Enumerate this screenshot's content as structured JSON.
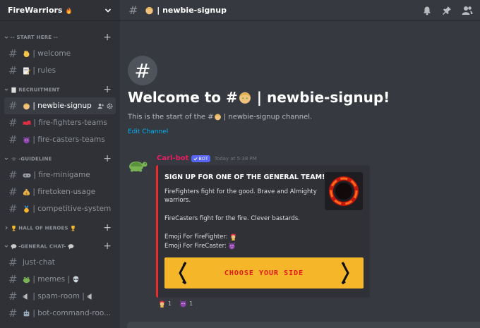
{
  "server": {
    "name": "FireWarriors"
  },
  "categories": [
    {
      "label": "-- START HERE --",
      "channels": [
        {
          "label": "| welcome"
        },
        {
          "label": "| rules"
        }
      ]
    },
    {
      "label": "RECRUITMENT",
      "channels": [
        {
          "label": "| newbie-signup"
        },
        {
          "label": "| fire-fighters-teams"
        },
        {
          "label": "| fire-casters-teams"
        }
      ]
    },
    {
      "label": "-GUIDELINE",
      "channels": [
        {
          "label": "| fire-minigame"
        },
        {
          "label": "| firetoken-usage"
        },
        {
          "label": "| competitive-system"
        }
      ]
    },
    {
      "label": "HALL OF HEROES",
      "channels": []
    },
    {
      "label": "-GENERAL CHAT-",
      "channels": [
        {
          "label": "just-chat"
        },
        {
          "label": "| memes |"
        },
        {
          "label": "| spam-room |"
        },
        {
          "label": "| bot-command-roo..."
        }
      ]
    }
  ],
  "topbar": {
    "title": "| newbie-signup"
  },
  "welcome": {
    "title_prefix": "Welcome to #",
    "title_suffix": " | newbie-signup!",
    "sub_prefix": "This is the start of the #",
    "sub_suffix": " | newbie-signup channel.",
    "edit_channel": "Edit Channel"
  },
  "message": {
    "author": "Carl-bot",
    "badge": "BOT",
    "timestamp": "Today at 5:38 PM",
    "embed": {
      "title": "SIGN UP FOR ONE OF THE GENERAL TEAM!",
      "line1": "FireFighters fight for the good. Brave and Almighty",
      "line2": "warriors.",
      "line3": "FireCasters fight for the fire. Clever bastards.",
      "line4": "Emoji For FireFighter:",
      "line5": "Emoji For FireCaster:",
      "banner": "CHOOSE YOUR SIDE"
    },
    "reactions": [
      {
        "count": "1"
      },
      {
        "count": "1"
      }
    ]
  },
  "colors": {
    "accent": "#5865f2",
    "author": "#e91e63",
    "embed_border": "#ed2b2b",
    "banner": "#f5b62a",
    "link": "#00b0f4"
  }
}
